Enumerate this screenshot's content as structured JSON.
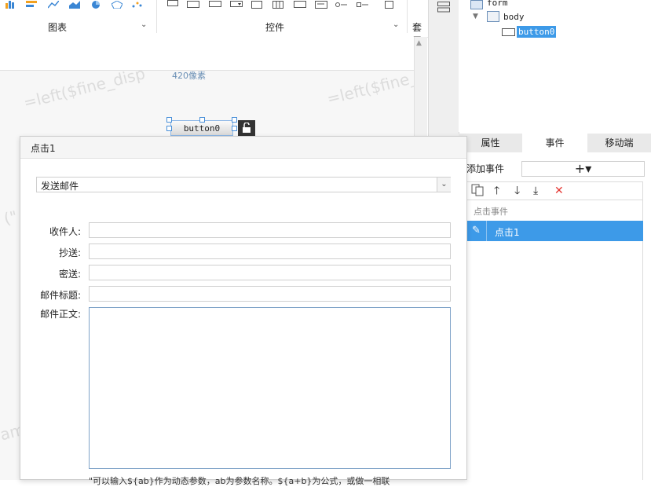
{
  "ribbon": {
    "groups": [
      {
        "label": "图表"
      },
      {
        "label": "控件"
      },
      {
        "label": "套用"
      }
    ]
  },
  "canvas": {
    "size_label": "420像素",
    "watermarks": [
      "=left($fine_disp",
      "=left($fine_",
      "(\"",
      "am"
    ],
    "button_label": "button0"
  },
  "tree": {
    "nodes": [
      {
        "label": "form"
      },
      {
        "label": "body"
      },
      {
        "label": "button0"
      }
    ]
  },
  "panel": {
    "tabs": [
      "属性",
      "事件",
      "移动端"
    ],
    "active_tab": "事件",
    "add_event_label": "添加事件",
    "add_button": "+▾",
    "event_group": "点击事件",
    "events": [
      "点击1"
    ]
  },
  "dialog": {
    "title": "点击1",
    "action": "发送邮件",
    "fields": {
      "to": "收件人:",
      "cc": "抄送:",
      "bcc": "密送:",
      "subject": "邮件标题:",
      "body": "邮件正文:"
    },
    "hint": "\"可以输入${ab}作为动态参数，ab为参数名称。${a+b}为公式，或做一相联"
  },
  "colors": {
    "selection": "#3d9ae8",
    "delete": "#e53935"
  }
}
